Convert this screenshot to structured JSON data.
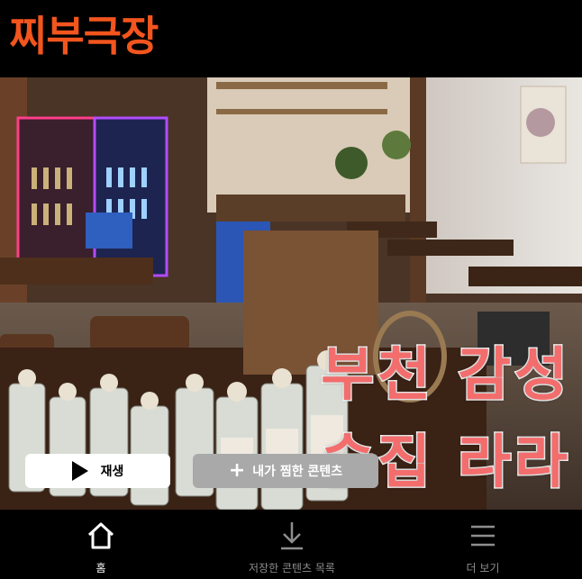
{
  "app": {
    "brand_title": "찌부극장",
    "brand_color": "#f2551e"
  },
  "hero": {
    "image_description_icon": "restaurant-photo",
    "overlay_line1": "부천 감성",
    "overlay_line2": "술집 라라",
    "overlay_color": "#f36d6d"
  },
  "actions": {
    "play_label": "재생",
    "favorite_label": "내가 찜한 콘텐츠"
  },
  "tabbar": {
    "items": [
      {
        "label": "홈",
        "icon": "home-icon",
        "active": true
      },
      {
        "label": "저장한 콘텐츠 목록",
        "icon": "download-icon",
        "active": false
      },
      {
        "label": "더 보기",
        "icon": "menu-icon",
        "active": false
      }
    ]
  }
}
